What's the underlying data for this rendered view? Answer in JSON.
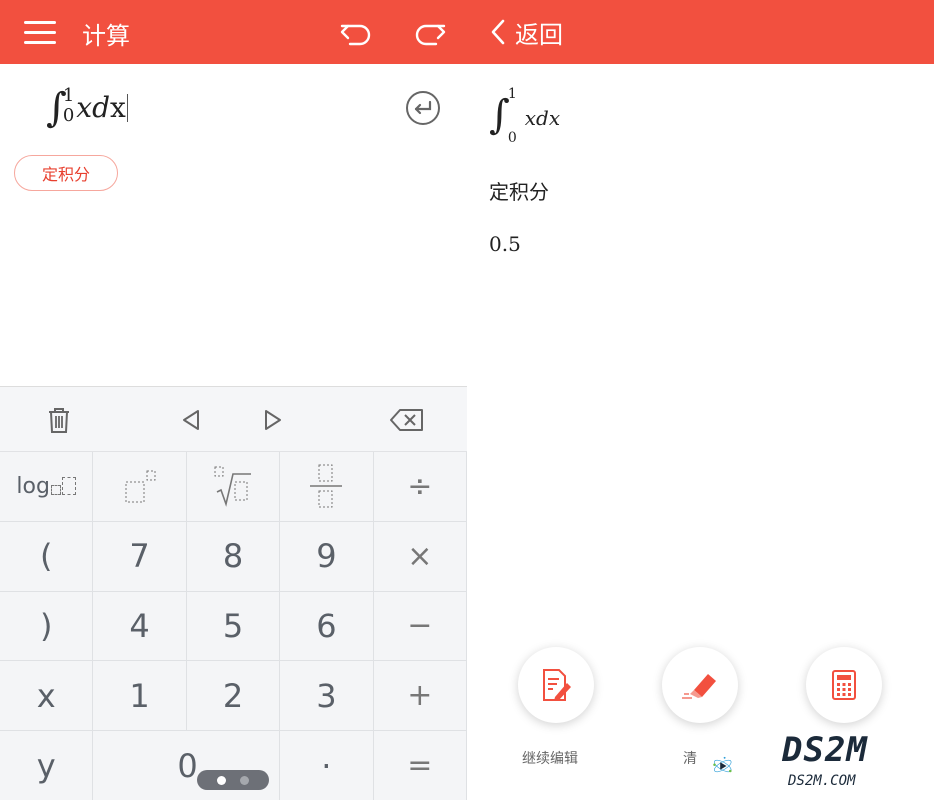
{
  "left": {
    "title": "计算",
    "input": {
      "integral_sign": "∫",
      "upper": "1",
      "lower": "0",
      "body": "xd",
      "body_tail": "x"
    },
    "chip_label": "定积分",
    "pager": {
      "active_color": "#ffffff",
      "inactive_color": "#a5a8ad"
    },
    "keys": [
      {
        "name": "key-log",
        "label": "log"
      },
      {
        "name": "key-power",
        "label": ""
      },
      {
        "name": "key-root",
        "label": ""
      },
      {
        "name": "key-fraction",
        "label": ""
      },
      {
        "name": "key-divide",
        "label": "÷"
      },
      {
        "name": "key-open-paren",
        "label": "("
      },
      {
        "name": "key-7",
        "label": "7"
      },
      {
        "name": "key-8",
        "label": "8"
      },
      {
        "name": "key-9",
        "label": "9"
      },
      {
        "name": "key-multiply",
        "label": "×"
      },
      {
        "name": "key-close-paren",
        "label": ")"
      },
      {
        "name": "key-4",
        "label": "4"
      },
      {
        "name": "key-5",
        "label": "5"
      },
      {
        "name": "key-6",
        "label": "6"
      },
      {
        "name": "key-minus",
        "label": "−"
      },
      {
        "name": "key-x",
        "label": "x"
      },
      {
        "name": "key-1",
        "label": "1"
      },
      {
        "name": "key-2",
        "label": "2"
      },
      {
        "name": "key-3",
        "label": "3"
      },
      {
        "name": "key-plus",
        "label": "+"
      },
      {
        "name": "key-y",
        "label": "y"
      },
      {
        "name": "key-0",
        "label": "0"
      },
      {
        "name": "key-empty",
        "label": ""
      },
      {
        "name": "key-dot",
        "label": "·"
      },
      {
        "name": "key-equals",
        "label": "="
      }
    ]
  },
  "right": {
    "back_label": "返回",
    "expression": {
      "upper": "1",
      "lower": "0",
      "body": "xdx",
      "integral_sign": "∫"
    },
    "result_label": "定积分",
    "result_value": "0.5",
    "actions": [
      {
        "label": "继续编辑",
        "icon": "edit-icon"
      },
      {
        "label": "清",
        "icon": "eraser-icon"
      },
      {
        "label": "",
        "icon": "calculator-icon"
      }
    ]
  },
  "watermark": {
    "title": "DS2M",
    "subtitle": "DS2M.COM"
  },
  "colors": {
    "accent": "#f2503f",
    "chip_border": "#f6a79d",
    "chip_text": "#e8402f"
  }
}
